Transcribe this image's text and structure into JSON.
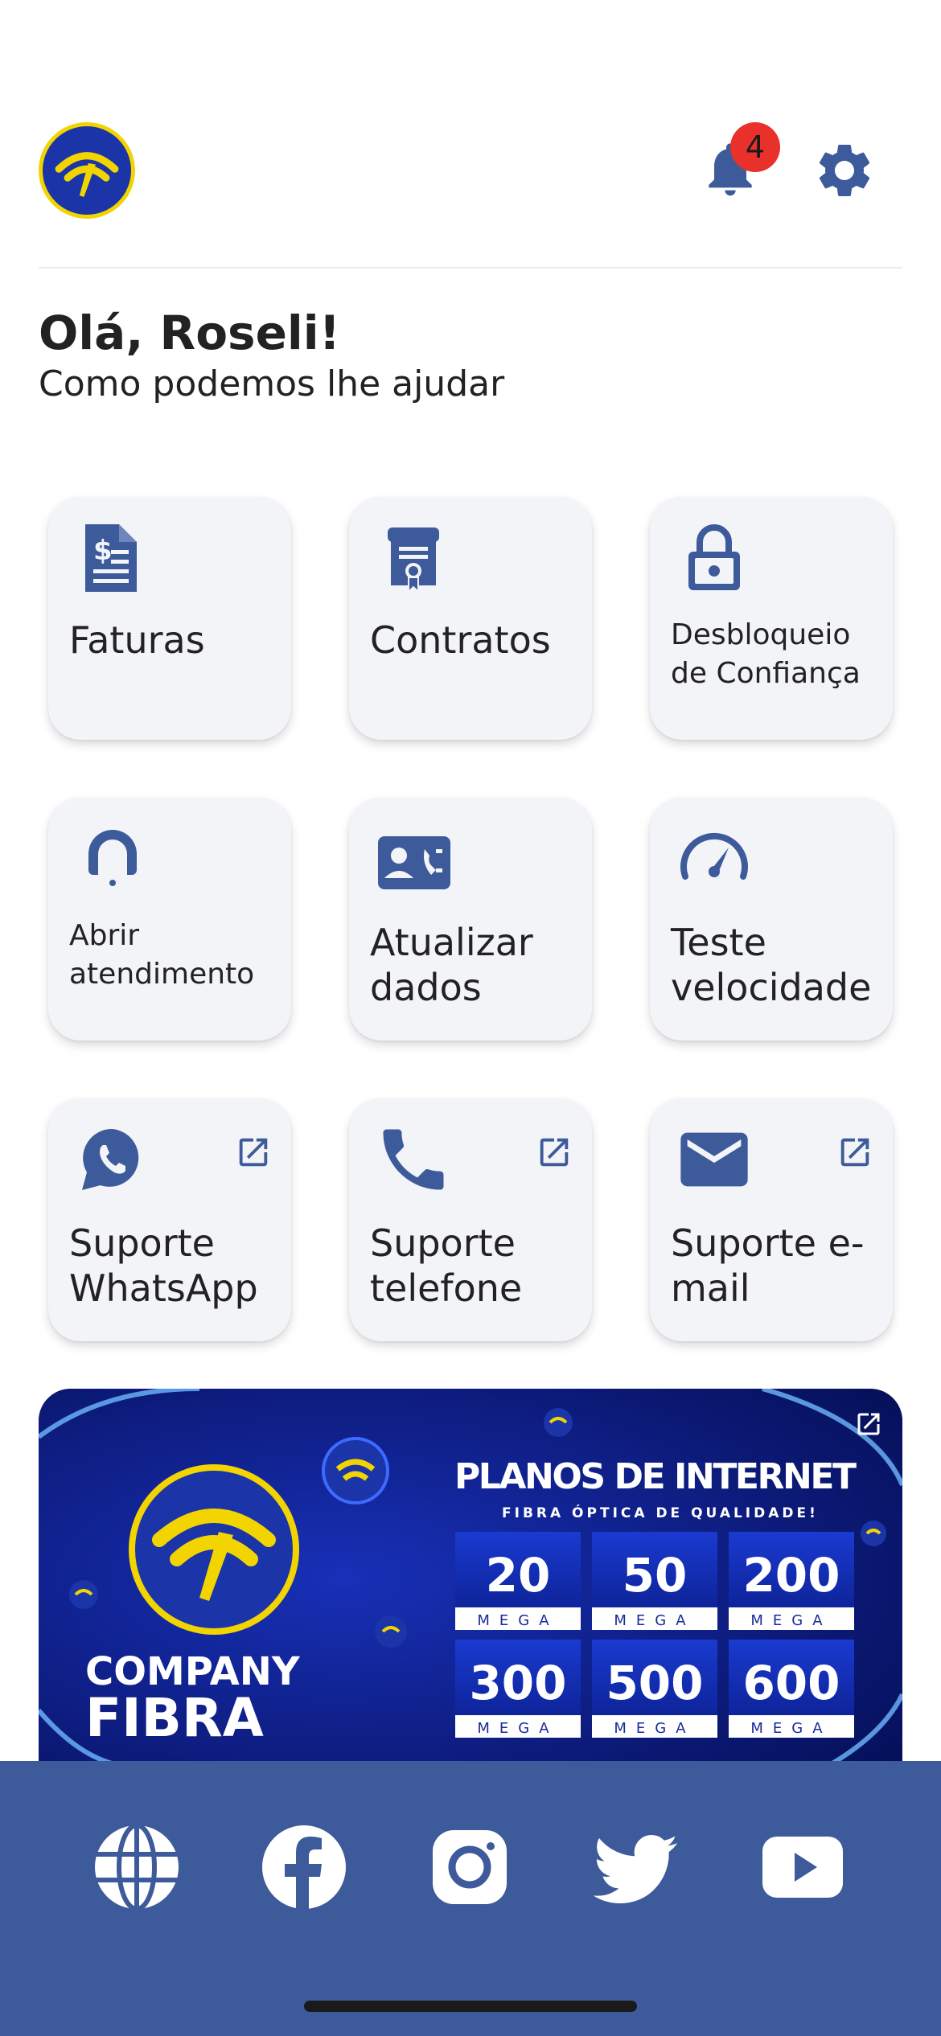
{
  "header": {
    "notification_count": "4"
  },
  "greeting": {
    "title": "Olá, Roseli!",
    "subtitle": "Como podemos lhe ajudar"
  },
  "menu": [
    {
      "label": "Faturas",
      "icon": "invoice-icon"
    },
    {
      "label": "Contratos",
      "icon": "contract-icon"
    },
    {
      "label": "Desbloqueio de Confiança",
      "icon": "unlock-icon"
    },
    {
      "label": "Abrir atendimento",
      "icon": "support-agent-icon"
    },
    {
      "label": "Atualizar dados",
      "icon": "contact-card-icon"
    },
    {
      "label": "Teste velocidade",
      "icon": "speedometer-icon"
    },
    {
      "label": "Suporte WhatsApp",
      "icon": "whatsapp-icon",
      "external": true
    },
    {
      "label": "Suporte telefone",
      "icon": "phone-icon",
      "external": true
    },
    {
      "label": "Suporte e-mail",
      "icon": "email-icon",
      "external": true
    }
  ],
  "banner": {
    "title": "PLANOS DE INTERNET",
    "subtitle": "FIBRA ÓPTICA DE QUALIDADE!",
    "brand_line1": "COMPANY",
    "brand_line2": "FIBRA",
    "unit": "MEGA",
    "plans": [
      "20",
      "50",
      "200",
      "300",
      "500",
      "600"
    ]
  },
  "social": [
    {
      "icon": "globe-icon"
    },
    {
      "icon": "facebook-icon"
    },
    {
      "icon": "instagram-icon"
    },
    {
      "icon": "twitter-icon"
    },
    {
      "icon": "youtube-icon"
    }
  ],
  "colors": {
    "primary": "#3d5a9a",
    "card_bg": "#f3f4f8",
    "badge": "#e8312b",
    "banner_bg": "#0a1a73",
    "brand_yellow": "#f2d400"
  }
}
